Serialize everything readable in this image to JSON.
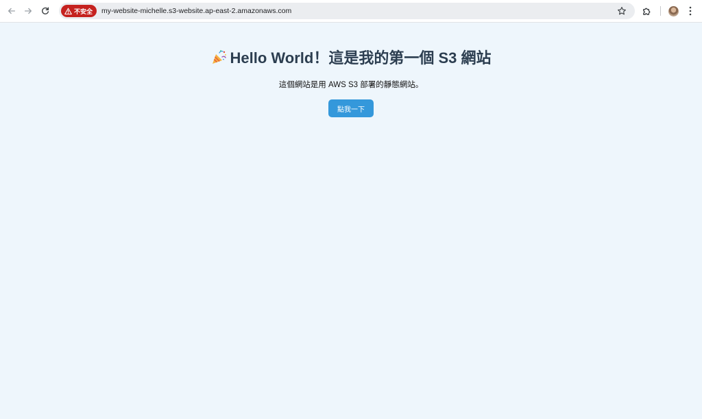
{
  "browser": {
    "security_chip_label": "不安全",
    "url": "my-website-michelle.s3-website.ap-east-2.amazonaws.com",
    "icons": {
      "back": "arrow-left-icon",
      "forward": "arrow-right-icon",
      "reload": "reload-icon",
      "warning": "warning-triangle-icon",
      "bookmark": "star-icon",
      "extensions": "puzzle-icon",
      "menu": "kebab-menu-icon"
    },
    "colors": {
      "security_chip": "#c5221f",
      "omnibox": "#ebedf0"
    }
  },
  "page": {
    "heading": "Hello World！這是我的第一個 S3 網站",
    "heading_icon": "party-popper-icon",
    "description": "這個網站是用 AWS S3 部署的靜態網站。",
    "button_label": "點我一下",
    "colors": {
      "background": "#eef6fc",
      "heading": "#2c3e50",
      "button": "#3498db"
    }
  }
}
